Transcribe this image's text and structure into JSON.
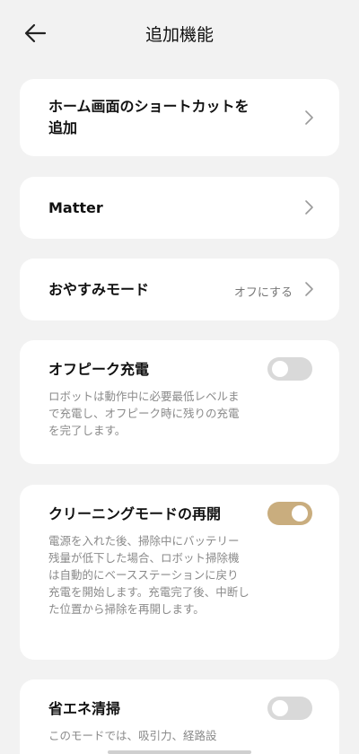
{
  "header": {
    "title": "追加機能",
    "back_icon": "back-arrow-icon"
  },
  "items": {
    "home_shortcut": {
      "line1": "ホーム画面のショートカットを",
      "line2": "追加"
    },
    "matter": {
      "title": "Matter"
    },
    "dnd": {
      "title": "おやすみモード",
      "value": "オフにする"
    },
    "offpeak": {
      "title": "オフピーク充電",
      "desc": "ロボットは動作中に必要最低レベルまで充電し、オフピーク時に残りの充電を完了します。",
      "enabled": false
    },
    "resume": {
      "title": "クリーニングモードの再開",
      "desc": "電源を入れた後、掃除中にバッテリー残量が低下した場合、ロボット掃除機は自動的にベースステーションに戻り充電を開始します。充電完了後、中断した位置から掃除を再開します。",
      "enabled": true
    },
    "eco": {
      "title": "省エネ清掃",
      "desc": "このモードでは、吸引力、経路設",
      "enabled": false
    }
  },
  "colors": {
    "background": "#f2f2f2",
    "card": "#ffffff",
    "toggle_on": "#c9ad7e",
    "toggle_off": "#d9d9d9"
  }
}
